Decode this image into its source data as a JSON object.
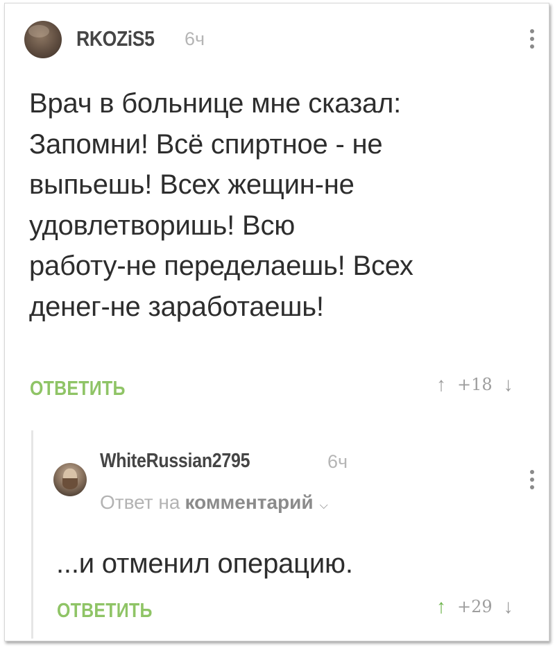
{
  "comment": {
    "username": "RKOZiS5",
    "time": "6ч",
    "lines": [
      "Врач в больнице мне сказал:",
      "Запомни! Всё спиртное - не",
      "выпьешь! Всех жещин-не",
      "удовлетворишь! Всю",
      "работу-не переделаешь! Всех",
      "денег-не заработаешь!"
    ],
    "reply_label": "ОТВЕТИТЬ",
    "score": "+18",
    "upvote_icon": "arrow-up-icon",
    "downvote_icon": "arrow-down-icon",
    "menu_icon": "kebab-menu-icon"
  },
  "reply": {
    "username": "WhiteRussian2795",
    "time": "6ч",
    "reply_to_prefix": "Ответ на",
    "reply_to_link": "комментарий",
    "reply_to_icon": "chevron-down-icon",
    "text": "...и отменил операцию.",
    "reply_label": "ОТВЕТИТЬ",
    "score": "+29",
    "upvote_icon": "arrow-up-icon",
    "downvote_icon": "arrow-down-icon",
    "menu_icon": "kebab-menu-icon"
  },
  "colors": {
    "reply_button": "#8fc466",
    "upvoted_arrow": "#6cb34a",
    "muted_text": "#b5b5b5",
    "body_text": "#2d2d2d"
  }
}
